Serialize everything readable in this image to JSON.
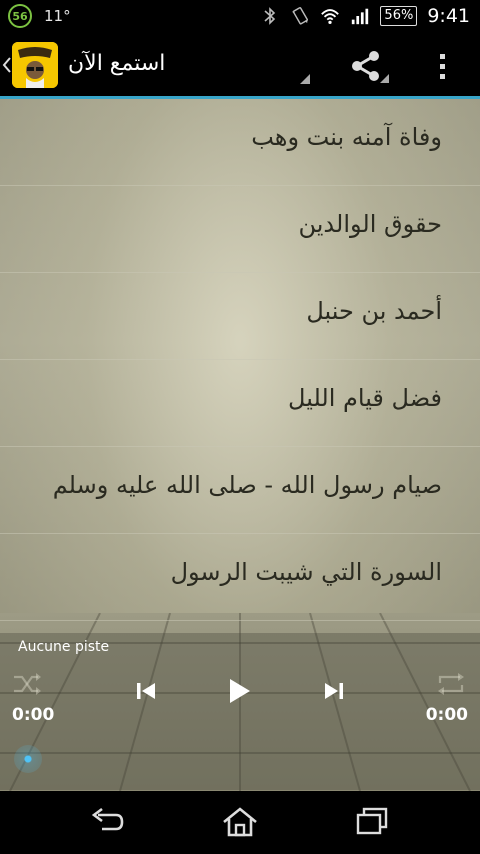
{
  "status_bar": {
    "notification_badge": "56",
    "temperature": "11°",
    "battery": "56%",
    "time": "9:41"
  },
  "action_bar": {
    "title": "استمع الآن",
    "accent_color": "#38a5c9"
  },
  "tracks": [
    {
      "label": "وفاة آمنه بنت وهب"
    },
    {
      "label": "حقوق الوالدين"
    },
    {
      "label": "أحمد بن حنبل"
    },
    {
      "label": "فضل قيام الليل"
    },
    {
      "label": "صيام رسول الله - صلى الله عليه وسلم"
    },
    {
      "label": "السورة التي شيبت الرسول"
    }
  ],
  "player": {
    "track_title": "Aucune piste",
    "current_time": "0:00",
    "total_time": "0:00",
    "progress": 0
  },
  "icons": {
    "shuffle": "shuffle-icon",
    "previous": "skip-previous-icon",
    "play": "play-icon",
    "next": "skip-next-icon",
    "repeat": "repeat-icon",
    "share": "share-icon",
    "overflow": "overflow-menu-icon"
  }
}
